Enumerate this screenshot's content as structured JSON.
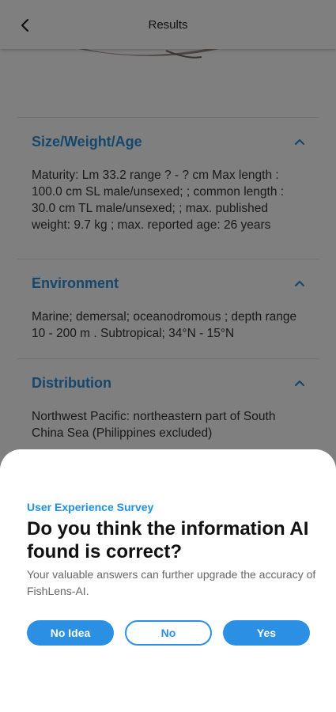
{
  "header": {
    "title": "Results",
    "back_icon": "chevron-left-icon"
  },
  "colors": {
    "accent": "#2b8fe4",
    "overlay": "rgba(0,0,0,0.5)"
  },
  "sections": [
    {
      "title": "Size/Weight/Age",
      "body": "Maturity: Lm 33.2  range ? - ? cm Max length : 100.0 cm SL male/unsexed; ; common length : 30.0 cm TL male/unsexed; ; max. published weight: 9.7 kg ; max. reported age: 26 years"
    },
    {
      "title": "Environment",
      "body": "Marine; demersal; oceanodromous ; depth range 10 - 200 m . Subtropical; 34°N - 15°N"
    },
    {
      "title": "Distribution",
      "body": "Northwest Pacific: northeastern part of South China Sea (Philippines excluded)"
    }
  ],
  "survey": {
    "label": "User Experience Survey",
    "question": "Do you think the information AI found is correct?",
    "description": "Your valuable answers can further upgrade the accuracy of FishLens-AI.",
    "buttons": {
      "no_idea": "No Idea",
      "no": "No",
      "yes": "Yes"
    }
  }
}
